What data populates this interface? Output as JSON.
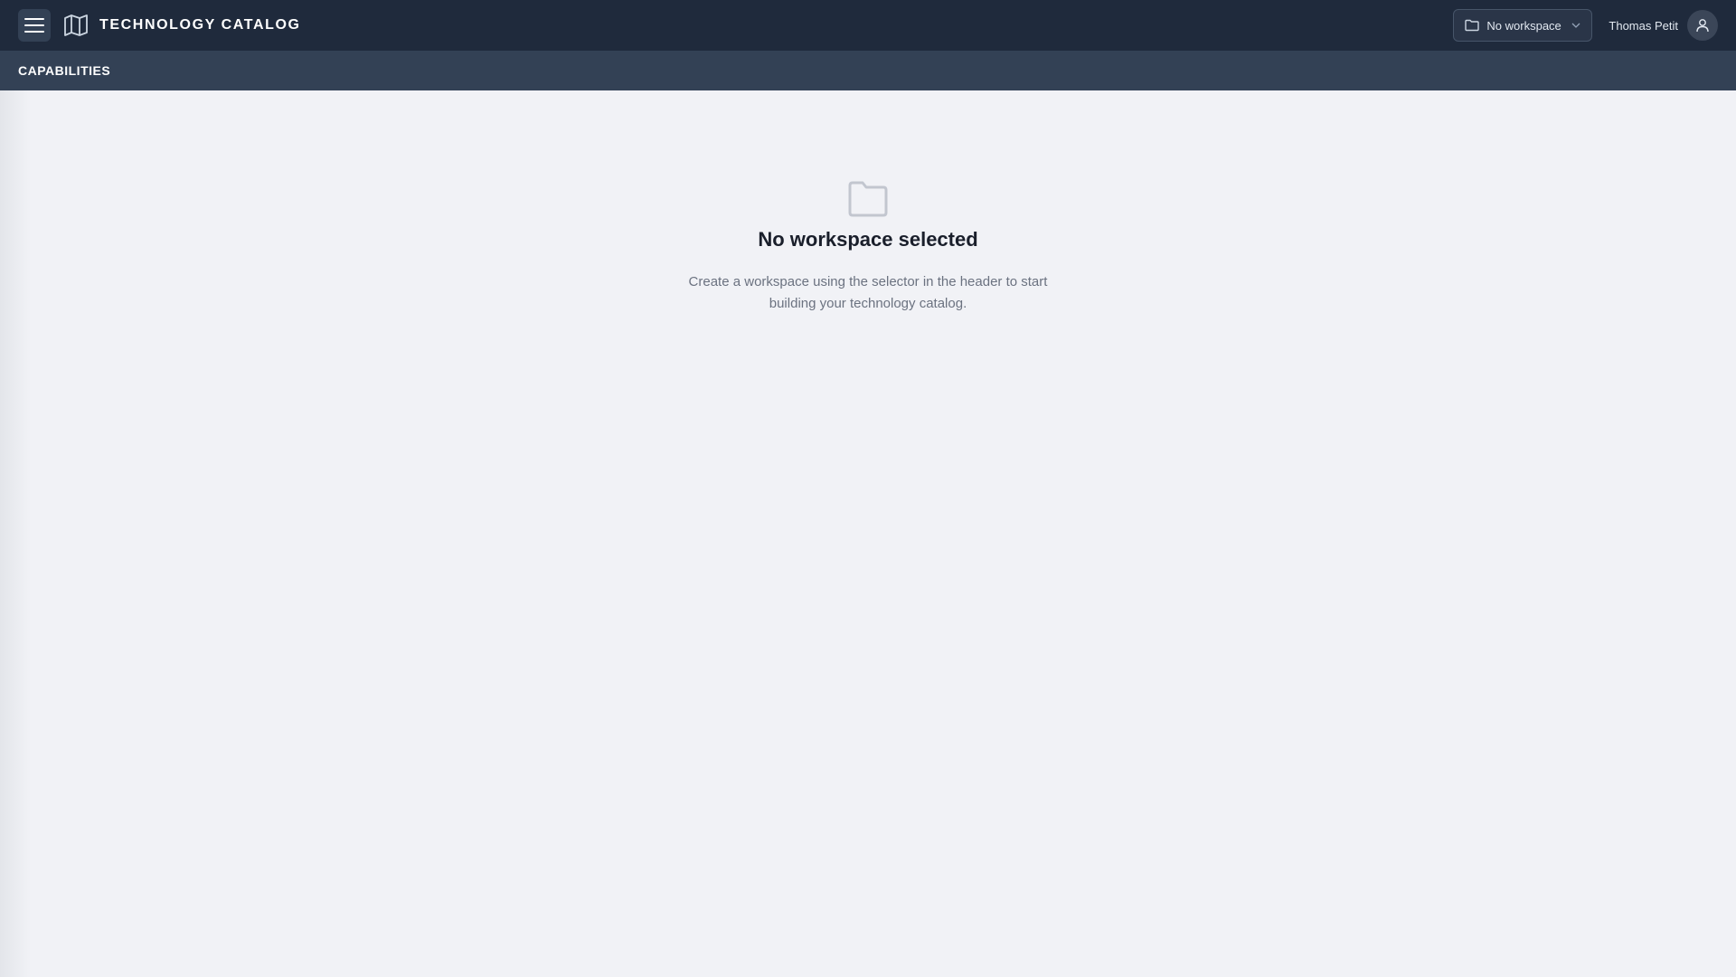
{
  "header": {
    "menu_icon": "hamburger-menu-icon",
    "brand_icon": "map-icon",
    "title": "TECHNOLOGY CATALOG",
    "workspace_selector": {
      "icon": "folder-icon",
      "value": "No workspace",
      "chevron": "chevron-down-icon"
    },
    "user": {
      "name": "Thomas Petit",
      "avatar_icon": "user-icon"
    }
  },
  "subheader": {
    "title": "CAPABILITIES"
  },
  "empty_state": {
    "icon": "folder-icon",
    "title": "No workspace selected",
    "description": "Create a workspace using the selector in the header to start building your technology catalog."
  },
  "colors": {
    "header_bg": "#1f2a3c",
    "subheader_bg": "#334155",
    "page_bg": "#f1f2f6",
    "title_text": "#1a1f2b",
    "muted_text": "#6b7280"
  }
}
